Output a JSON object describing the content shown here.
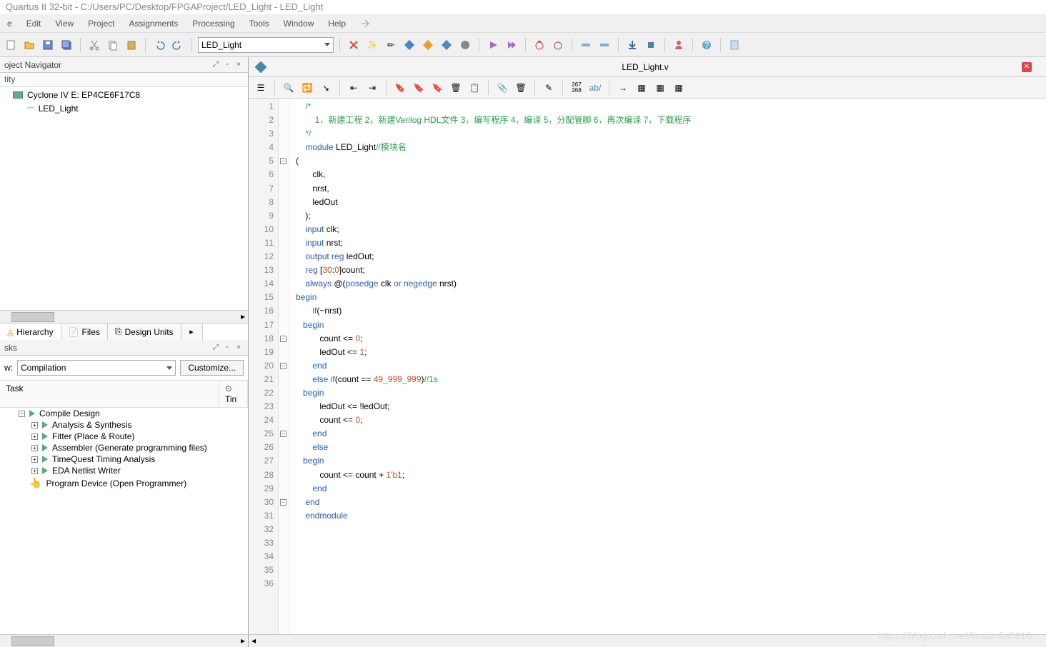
{
  "title": "Quartus II 32-bit - C:/Users/PC/Desktop/FPGAProject/LED_Light - LED_Light",
  "menubar": [
    "e",
    "Edit",
    "View",
    "Project",
    "Assignments",
    "Processing",
    "Tools",
    "Window",
    "Help"
  ],
  "toolbar_combo": "LED_Light",
  "watermark": "https://blog.csdn.net/liuxianfei0810",
  "navigator": {
    "title": "oject Navigator",
    "col_header": "tity",
    "device": "Cyclone IV E: EP4CE6F17C8",
    "entity": "LED_Light",
    "tabs": [
      "Hierarchy",
      "Files",
      "Design Units"
    ]
  },
  "tasks": {
    "title": "sks",
    "flow_label": "w:",
    "flow_value": "Compilation",
    "customize": "Customize...",
    "cols": [
      "Task",
      "Tin"
    ],
    "rows": [
      {
        "lvl": 0,
        "icon": "play",
        "label": "Compile Design"
      },
      {
        "lvl": 1,
        "icon": "play",
        "label": "Analysis & Synthesis"
      },
      {
        "lvl": 1,
        "icon": "play",
        "label": "Fitter (Place & Route)"
      },
      {
        "lvl": 1,
        "icon": "play",
        "label": "Assembler (Generate programming files)"
      },
      {
        "lvl": 1,
        "icon": "play",
        "label": "TimeQuest Timing Analysis"
      },
      {
        "lvl": 1,
        "icon": "play",
        "label": "EDA Netlist Writer"
      },
      {
        "lvl": 0,
        "icon": "hand",
        "label": "Program Device (Open Programmer)"
      }
    ]
  },
  "doc_tab": "LED_Light.v",
  "code_lines": [
    {
      "n": 1,
      "fold": "",
      "tokens": [
        [
          "    ",
          ""
        ],
        [
          "/*",
          "cmt"
        ]
      ]
    },
    {
      "n": 2,
      "fold": "",
      "tokens": [
        [
          "        ",
          ""
        ],
        [
          "1，新建工程 2，新建Verilog HDL文件 3，编写程序 4，编译 5，分配管脚 6，再次编译 7，下载程序",
          "cmt"
        ]
      ]
    },
    {
      "n": 3,
      "fold": "",
      "tokens": [
        [
          "    ",
          ""
        ],
        [
          "*/",
          "cmt"
        ]
      ]
    },
    {
      "n": 4,
      "fold": "",
      "tokens": [
        [
          "    ",
          ""
        ],
        [
          "module",
          "kw"
        ],
        [
          " LED_Light",
          ""
        ],
        [
          "//模块名",
          "cmt"
        ]
      ]
    },
    {
      "n": 5,
      "fold": "-",
      "tokens": [
        [
          "(",
          ""
        ]
      ]
    },
    {
      "n": 6,
      "fold": "",
      "tokens": [
        [
          "       clk,",
          ""
        ]
      ]
    },
    {
      "n": 7,
      "fold": "",
      "tokens": [
        [
          "       nrst,",
          ""
        ]
      ]
    },
    {
      "n": 8,
      "fold": "",
      "tokens": [
        [
          "       ledOut",
          ""
        ]
      ]
    },
    {
      "n": 9,
      "fold": "",
      "tokens": [
        [
          "    );",
          ""
        ]
      ]
    },
    {
      "n": 10,
      "fold": "",
      "tokens": [
        [
          "",
          ""
        ]
      ]
    },
    {
      "n": 11,
      "fold": "",
      "tokens": [
        [
          "    ",
          ""
        ],
        [
          "input",
          "kw"
        ],
        [
          " clk;",
          ""
        ]
      ]
    },
    {
      "n": 12,
      "fold": "",
      "tokens": [
        [
          "    ",
          ""
        ],
        [
          "input",
          "kw"
        ],
        [
          " nrst;",
          ""
        ]
      ]
    },
    {
      "n": 13,
      "fold": "",
      "tokens": [
        [
          "    ",
          ""
        ],
        [
          "output reg",
          "kw"
        ],
        [
          " ledOut;",
          ""
        ]
      ]
    },
    {
      "n": 14,
      "fold": "",
      "tokens": [
        [
          "",
          ""
        ]
      ]
    },
    {
      "n": 15,
      "fold": "",
      "tokens": [
        [
          "    ",
          ""
        ],
        [
          "reg",
          "kw"
        ],
        [
          " [",
          ""
        ],
        [
          "30",
          "num"
        ],
        [
          ":",
          ""
        ],
        [
          "0",
          "num"
        ],
        [
          "]count;",
          ""
        ]
      ]
    },
    {
      "n": 16,
      "fold": "",
      "tokens": [
        [
          "",
          ""
        ]
      ]
    },
    {
      "n": 17,
      "fold": "",
      "tokens": [
        [
          "    ",
          ""
        ],
        [
          "always",
          "kw"
        ],
        [
          " @(",
          ""
        ],
        [
          "posedge",
          "kw"
        ],
        [
          " clk ",
          ""
        ],
        [
          "or",
          "kw"
        ],
        [
          " ",
          ""
        ],
        [
          "negedge",
          "kw"
        ],
        [
          " nrst)",
          ""
        ]
      ]
    },
    {
      "n": 18,
      "fold": "-",
      "tokens": [
        [
          "begin",
          "kw"
        ]
      ]
    },
    {
      "n": 19,
      "fold": "",
      "tokens": [
        [
          "       ",
          ""
        ],
        [
          "if",
          "kw"
        ],
        [
          "(~nrst)",
          ""
        ]
      ]
    },
    {
      "n": 20,
      "fold": "-",
      "tokens": [
        [
          "   ",
          ""
        ],
        [
          "begin",
          "kw"
        ]
      ]
    },
    {
      "n": 21,
      "fold": "",
      "tokens": [
        [
          "          count <= ",
          ""
        ],
        [
          "0",
          "num"
        ],
        [
          ";",
          ""
        ]
      ]
    },
    {
      "n": 22,
      "fold": "",
      "tokens": [
        [
          "          ledOut <= ",
          ""
        ],
        [
          "1",
          "num"
        ],
        [
          ";",
          ""
        ]
      ]
    },
    {
      "n": 23,
      "fold": "",
      "tokens": [
        [
          "       ",
          ""
        ],
        [
          "end",
          "kw"
        ]
      ]
    },
    {
      "n": 24,
      "fold": "",
      "tokens": [
        [
          "       ",
          ""
        ],
        [
          "else if",
          "kw"
        ],
        [
          "(count == ",
          ""
        ],
        [
          "49_999_999",
          "num"
        ],
        [
          ")",
          ""
        ],
        [
          "//1s",
          "cmt"
        ]
      ]
    },
    {
      "n": 25,
      "fold": "-",
      "tokens": [
        [
          "   ",
          ""
        ],
        [
          "begin",
          "kw"
        ]
      ]
    },
    {
      "n": 26,
      "fold": "",
      "tokens": [
        [
          "          ledOut <= !ledOut;",
          ""
        ]
      ]
    },
    {
      "n": 27,
      "fold": "",
      "tokens": [
        [
          "          count <= ",
          ""
        ],
        [
          "0",
          "num"
        ],
        [
          ";",
          ""
        ]
      ]
    },
    {
      "n": 28,
      "fold": "",
      "tokens": [
        [
          "       ",
          ""
        ],
        [
          "end",
          "kw"
        ]
      ]
    },
    {
      "n": 29,
      "fold": "",
      "tokens": [
        [
          "       ",
          ""
        ],
        [
          "else",
          "kw"
        ]
      ]
    },
    {
      "n": 30,
      "fold": "-",
      "tokens": [
        [
          "   ",
          ""
        ],
        [
          "begin",
          "kw"
        ]
      ]
    },
    {
      "n": 31,
      "fold": "",
      "tokens": [
        [
          "          count <= count + ",
          ""
        ],
        [
          "1'b1",
          "num"
        ],
        [
          ";",
          ""
        ]
      ]
    },
    {
      "n": 32,
      "fold": "",
      "tokens": [
        [
          "       ",
          ""
        ],
        [
          "end",
          "kw"
        ]
      ]
    },
    {
      "n": 33,
      "fold": "",
      "tokens": [
        [
          "",
          ""
        ]
      ]
    },
    {
      "n": 34,
      "fold": "",
      "tokens": [
        [
          "    ",
          ""
        ],
        [
          "end",
          "kw"
        ]
      ]
    },
    {
      "n": 35,
      "fold": "",
      "tokens": [
        [
          "    ",
          ""
        ],
        [
          "endmodule",
          "kw"
        ]
      ]
    },
    {
      "n": 36,
      "fold": "",
      "tokens": [
        [
          "",
          ""
        ]
      ]
    }
  ]
}
